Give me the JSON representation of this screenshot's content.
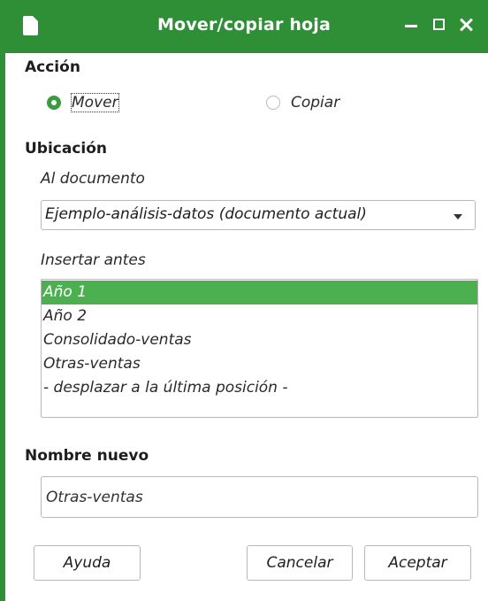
{
  "window": {
    "title": "Mover/copiar hoja",
    "accent_color": "#2f8f36",
    "icon": "document-icon"
  },
  "action": {
    "heading": "Acción",
    "options": [
      {
        "label": "Mover",
        "selected": true
      },
      {
        "label": "Copiar",
        "selected": false
      }
    ]
  },
  "location": {
    "heading": "Ubicación",
    "document_label": "Al documento",
    "document_value": "Ejemplo-análisis-datos (documento actual)",
    "insert_before_label": "Insertar antes",
    "sheets": [
      {
        "label": "Año 1",
        "selected": true
      },
      {
        "label": "Año 2",
        "selected": false
      },
      {
        "label": "Consolidado-ventas",
        "selected": false
      },
      {
        "label": "Otras-ventas",
        "selected": false
      },
      {
        "label": "- desplazar a la última posición -",
        "selected": false
      }
    ]
  },
  "new_name": {
    "heading": "Nombre nuevo",
    "value": "Otras-ventas"
  },
  "buttons": {
    "help": "Ayuda",
    "cancel": "Cancelar",
    "ok": "Aceptar"
  }
}
